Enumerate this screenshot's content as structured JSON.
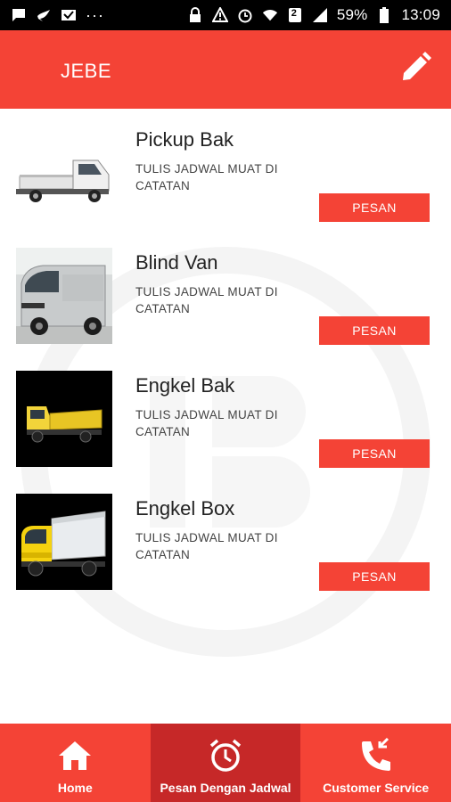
{
  "status_bar": {
    "battery_percent": "59%",
    "time": "13:09",
    "overflow_dots": "···",
    "notification_count": "2"
  },
  "app_bar": {
    "title": "JEBE",
    "edit_icon": "pencil-icon"
  },
  "vehicles": [
    {
      "title": "Pickup Bak",
      "description": "TULIS JADWAL MUAT DI CATATAN",
      "button_label": "PESAN",
      "image": "pickup-truck-image"
    },
    {
      "title": "Blind Van",
      "description": "TULIS JADWAL MUAT DI CATATAN",
      "button_label": "PESAN",
      "image": "van-image"
    },
    {
      "title": "Engkel Bak",
      "description": "TULIS JADWAL MUAT DI CATATAN",
      "button_label": "PESAN",
      "image": "dump-truck-image"
    },
    {
      "title": "Engkel Box",
      "description": "TULIS JADWAL MUAT DI CATATAN",
      "button_label": "PESAN",
      "image": "box-truck-image"
    }
  ],
  "bottom_nav": {
    "items": [
      {
        "label": "Home",
        "icon": "home-icon",
        "active": false
      },
      {
        "label": "Pesan Dengan Jadwal",
        "icon": "alarm-clock-icon",
        "active": true
      },
      {
        "label": "Customer Service",
        "icon": "phone-forward-icon",
        "active": false
      }
    ]
  },
  "colors": {
    "primary": "#f44336",
    "primary_dark": "#c62828",
    "status_bar": "#000000"
  }
}
